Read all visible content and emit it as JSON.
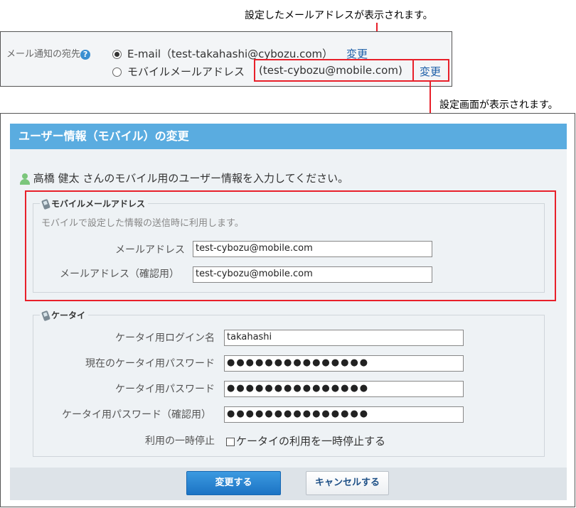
{
  "annotations": {
    "top_note": "設定したメールアドレスが表示されます。",
    "right_note": "設定画面が表示されます。"
  },
  "notify_panel": {
    "label": "メール通知の宛先",
    "help_icon": "question-circle-icon",
    "options": [
      {
        "text": "E-mail（test-takahashi@cybozu.com）",
        "selected": true,
        "link": "変更"
      },
      {
        "text": "モバイルメールアドレス",
        "address": "(test-cybozu@mobile.com)",
        "selected": false,
        "link": "変更"
      }
    ]
  },
  "dialog": {
    "title": "ユーザー情報（モバイル）の変更",
    "intro_user": "高橋 健太",
    "intro_text": "さんのモバイル用のユーザー情報を入力してください。",
    "mobile_section": {
      "legend": "モバイルメールアドレス",
      "description": "モバイルで設定した情報の送信時に利用します。",
      "fields": [
        {
          "label": "メールアドレス",
          "value": "test-cybozu@mobile.com"
        },
        {
          "label": "メールアドレス（確認用）",
          "value": "test-cybozu@mobile.com"
        }
      ]
    },
    "keitai_section": {
      "legend": "ケータイ",
      "fields": [
        {
          "label": "ケータイ用ログイン名",
          "value": "takahashi"
        },
        {
          "label": "現在のケータイ用パスワード",
          "value": "●●●●●●●●●●●●●●●"
        },
        {
          "label": "ケータイ用パスワード",
          "value": "●●●●●●●●●●●●●●●"
        },
        {
          "label": "ケータイ用パスワード（確認用）",
          "value": "●●●●●●●●●●●●●●●"
        }
      ],
      "pause_label": "利用の一時停止",
      "pause_checkbox": "ケータイの利用を一時停止する",
      "pause_checked": false
    },
    "buttons": {
      "submit": "変更する",
      "cancel": "キャンセルする"
    }
  },
  "colors": {
    "accent": "#5aace0",
    "highlight": "#e8202a",
    "link": "#1d5fa8"
  }
}
